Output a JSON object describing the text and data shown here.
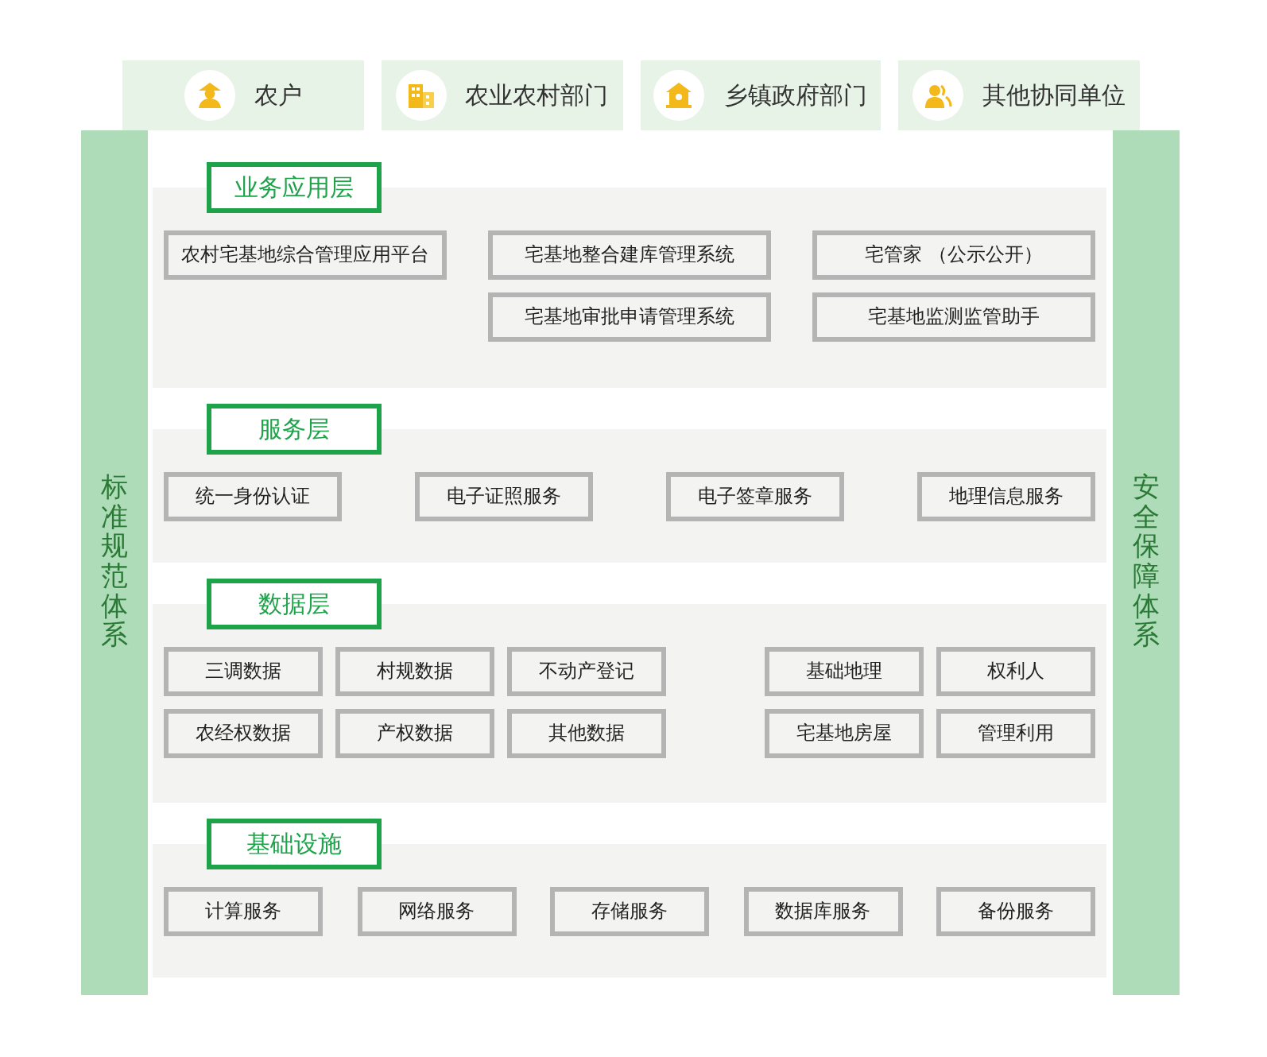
{
  "users": [
    {
      "label": "农户"
    },
    {
      "label": "农业农村部门"
    },
    {
      "label": "乡镇政府部门"
    },
    {
      "label": "其他协同单位"
    }
  ],
  "left_pillar": "标准规范体系",
  "right_pillar": "安全保障体系",
  "layers": [
    {
      "title": "业务应用层",
      "groups": [
        {
          "columns": [
            [
              "农村宅基地综合管理应用平台"
            ]
          ]
        },
        {
          "columns": [
            [
              "宅基地整合建库管理系统",
              "宅基地审批申请管理系统"
            ]
          ]
        },
        {
          "columns": [
            [
              "宅管家 （公示公开）",
              "宅基地监测监管助手"
            ]
          ]
        }
      ]
    },
    {
      "title": "服务层",
      "groups": [
        {
          "columns": [
            [
              "统一身份认证"
            ]
          ]
        },
        {
          "columns": [
            [
              "电子证照服务"
            ]
          ]
        },
        {
          "columns": [
            [
              "电子签章服务"
            ]
          ]
        },
        {
          "columns": [
            [
              "地理信息服务"
            ]
          ]
        }
      ]
    },
    {
      "title": "数据层",
      "groups": [
        {
          "columns": [
            [
              "三调数据",
              "农经权数据"
            ],
            [
              "村规数据",
              "产权数据"
            ],
            [
              "不动产登记",
              "其他数据"
            ]
          ]
        },
        {
          "columns": [
            [
              "基础地理",
              "宅基地房屋"
            ],
            [
              "权利人",
              "管理利用"
            ]
          ]
        }
      ]
    },
    {
      "title": "基础设施",
      "groups": [
        {
          "columns": [
            [
              "计算服务"
            ]
          ]
        },
        {
          "columns": [
            [
              "网络服务"
            ]
          ]
        },
        {
          "columns": [
            [
              "存储服务"
            ]
          ]
        },
        {
          "columns": [
            [
              "数据库服务"
            ]
          ]
        },
        {
          "columns": [
            [
              "备份服务"
            ]
          ]
        }
      ]
    }
  ]
}
